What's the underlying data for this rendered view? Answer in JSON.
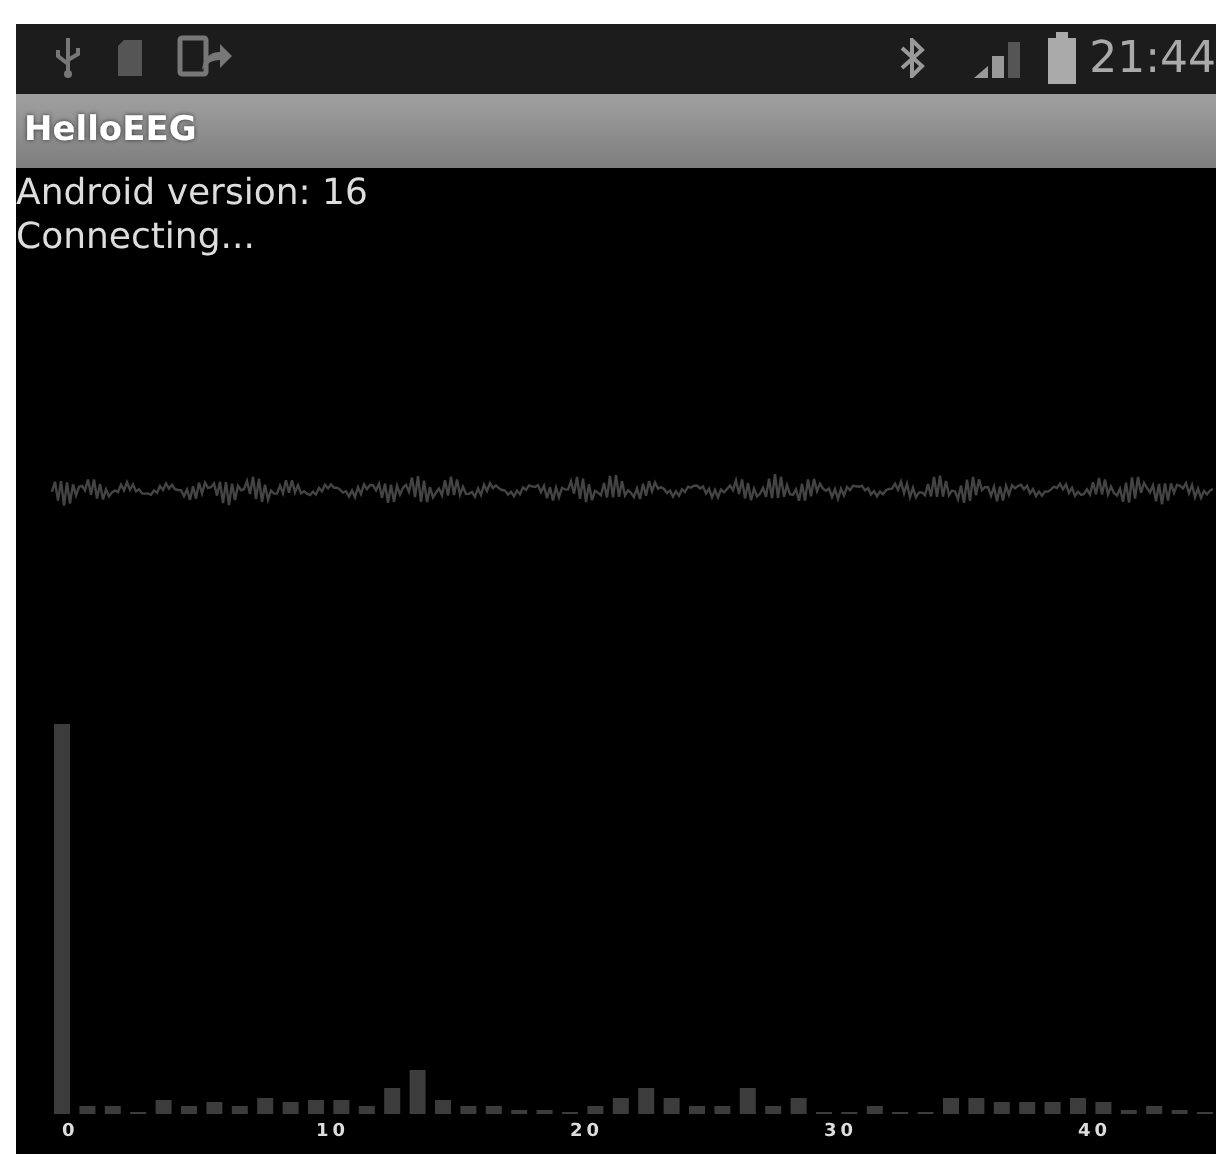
{
  "status_bar": {
    "time": "21:44"
  },
  "title_bar": {
    "title": "HelloEEG"
  },
  "messages": [
    "Android version: 16",
    "Connecting..."
  ],
  "spectrum": {
    "x_labels": [
      "0",
      "10",
      "20",
      "30",
      "40"
    ]
  }
}
